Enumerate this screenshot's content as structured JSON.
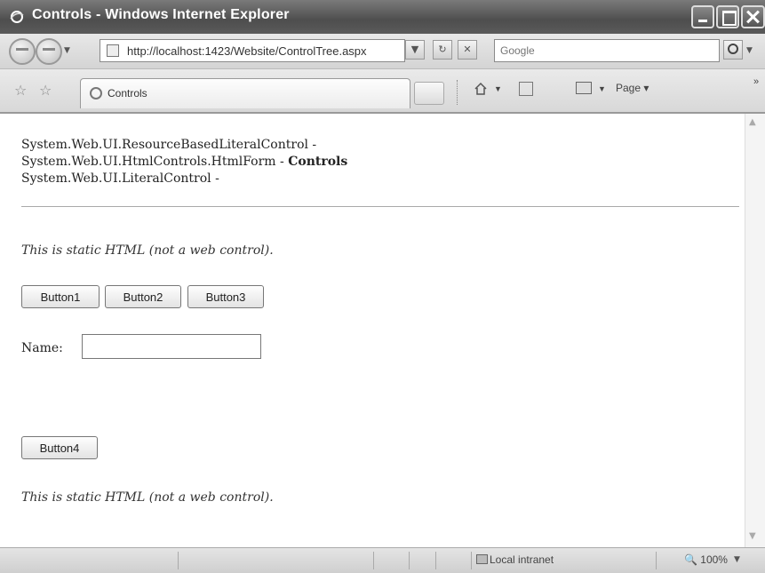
{
  "window": {
    "title": "Controls - Windows Internet Explorer"
  },
  "addressbar": {
    "url": "http://localhost:1423/Website/ControlTree.aspx",
    "search_placeholder": "Google"
  },
  "tabs": [
    {
      "label": "Controls"
    }
  ],
  "commandbar": {
    "page_label": "Page"
  },
  "content": {
    "tree_lines": [
      {
        "text": "System.Web.UI.ResourceBasedLiteralControl - ",
        "bold": ""
      },
      {
        "text": "System.Web.UI.HtmlControls.HtmlForm - ",
        "bold": "Controls"
      },
      {
        "text": "System.Web.UI.LiteralControl - ",
        "bold": ""
      }
    ],
    "static_html_text": "This is static HTML (not a web control).",
    "buttons": [
      "Button1",
      "Button2",
      "Button3"
    ],
    "name_label": "Name:",
    "name_value": "",
    "button4": "Button4",
    "static_html_text_2": "This is static HTML (not a web control)."
  },
  "statusbar": {
    "zone": "Local intranet",
    "zoom": "100%"
  },
  "icons": {
    "back": "back-arrow-icon",
    "forward": "forward-arrow-icon",
    "refresh": "refresh-icon",
    "stop": "stop-icon",
    "search": "search-icon",
    "favorites": "favorites-star-icon",
    "home": "home-icon",
    "feeds": "feeds-icon",
    "print": "print-icon"
  }
}
